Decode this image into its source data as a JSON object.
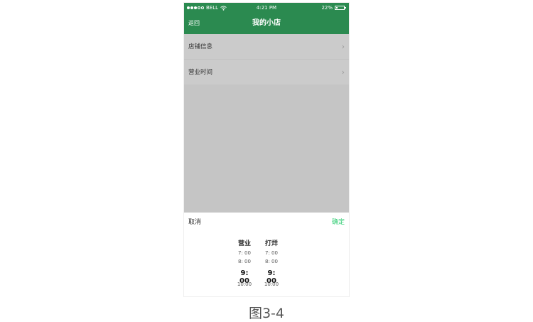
{
  "status": {
    "carrier": "BELL",
    "time": "4:21 PM",
    "battery": "22%",
    "battery_level": 0.22,
    "signal_dots": 5,
    "signal_filled": 3
  },
  "navbar": {
    "back_label": "返回",
    "title": "我的小店"
  },
  "menu": {
    "items": [
      {
        "label": "店铺信息"
      },
      {
        "label": "营业时间"
      }
    ]
  },
  "picker": {
    "cancel_label": "取消",
    "confirm_label": "确定",
    "columns": [
      {
        "header": "营业",
        "rows": [
          "7: 00",
          "8: 00",
          "9: 00",
          "10:00"
        ]
      },
      {
        "header": "打烊",
        "rows": [
          "7: 00",
          "8: 00",
          "9: 00",
          "10:00"
        ]
      }
    ],
    "selected_index": 2
  },
  "caption": "图3-4",
  "colors": {
    "brand_green": "#2b8a50",
    "confirm_green": "#2ecc71"
  }
}
